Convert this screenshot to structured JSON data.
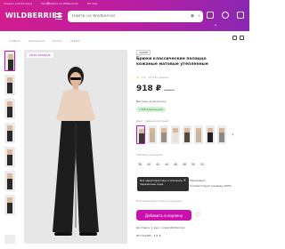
{
  "header": {
    "strip": [
      "Скидки для бизнеса",
      "Продавайте на Wildberries",
      "Москва"
    ],
    "logo": "WILDBERRIES",
    "search_placeholder": "Найти на Wildberries"
  },
  "breadcrumbs": [
    "Главная",
    "Женщинам",
    "Брюки",
    "ЧАЕКИ"
  ],
  "photo": {
    "badge": "ХИТЫ ПРОДАЖ"
  },
  "product": {
    "brand": "ЧАЕКИ",
    "title": "Брюки классические палаццо кожаные матовые утепленные",
    "rating": "4.6",
    "reviews": "32 235 оценок",
    "price": "918 ₽",
    "old_price": "3 450 ₽",
    "discount": "−73%",
    "installment": "Выгодно в рассрочку",
    "wallet": "с WB Кошельком",
    "color_label": "Цвет: черный матовый",
    "size_table_label": "Таблица размеров",
    "sizes": [
      "38",
      "40",
      "42",
      "44",
      "46",
      "48",
      "50",
      "52"
    ],
    "tooltip": "Все характеристики и описание перенесены сюда",
    "fits_1": "Маломерит",
    "fits_2": "Соответствует размеру 100%",
    "fit_info": "Все характеристики и описание",
    "cta_label": "Добавить в корзину",
    "delivery": "Доставка: 1 дек, склад Wildberries",
    "seller": "ИП НАСИМ · 4.8 ★"
  },
  "colors": {
    "accent": "#cb11ab",
    "header_start": "#d21d8f",
    "header_end": "#8a27b3"
  },
  "icons": [
    "menu-icon",
    "search-icon",
    "camera-icon",
    "location-icon",
    "profile-icon",
    "cart-icon",
    "heart-icon",
    "share-icon",
    "compare-icon",
    "star-icon",
    "chevron-right-icon",
    "close-icon"
  ]
}
